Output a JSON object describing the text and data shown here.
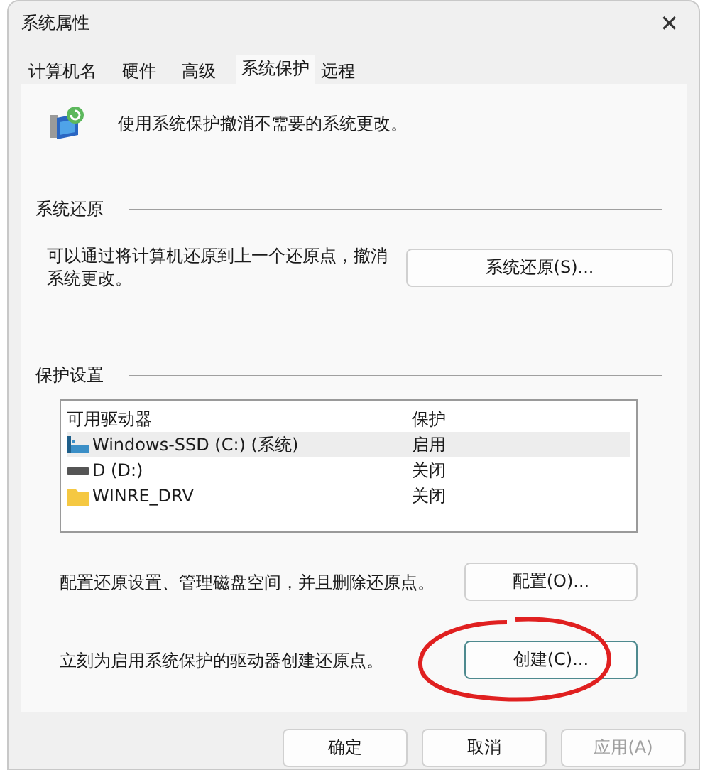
{
  "window": {
    "title": "系统属性",
    "close": "✕"
  },
  "tabs": [
    {
      "label": "计算机名",
      "selected": false
    },
    {
      "label": "硬件",
      "selected": false
    },
    {
      "label": "高级",
      "selected": false
    },
    {
      "label": "系统保护",
      "selected": true
    },
    {
      "label": "远程",
      "selected": false
    }
  ],
  "intro": "使用系统保护撤消不需要的系统更改。",
  "restore_group": {
    "title": "系统还原",
    "description": "可以通过将计算机还原到上一个还原点，撤消系统更改。",
    "button": "系统还原(S)..."
  },
  "protection_group": {
    "title": "保护设置",
    "columns": [
      "可用驱动器",
      "保护"
    ],
    "drives": [
      {
        "kind": "system",
        "name": "Windows-SSD (C:) (系统)",
        "protection": "启用",
        "selected": true
      },
      {
        "kind": "disk",
        "name": "D (D:)",
        "protection": "关闭",
        "selected": false
      },
      {
        "kind": "folder",
        "name": "WINRE_DRV",
        "protection": "关闭",
        "selected": false
      }
    ],
    "configure_text": "配置还原设置、管理磁盘空间，并且删除还原点。",
    "configure_button": "配置(O)...",
    "create_text": "立刻为启用系统保护的驱动器创建还原点。",
    "create_button": "创建(C)..."
  },
  "buttons": [
    {
      "label": "确定",
      "disabled": false
    },
    {
      "label": "取消",
      "disabled": false
    },
    {
      "label": "应用(A)",
      "disabled": true
    }
  ]
}
